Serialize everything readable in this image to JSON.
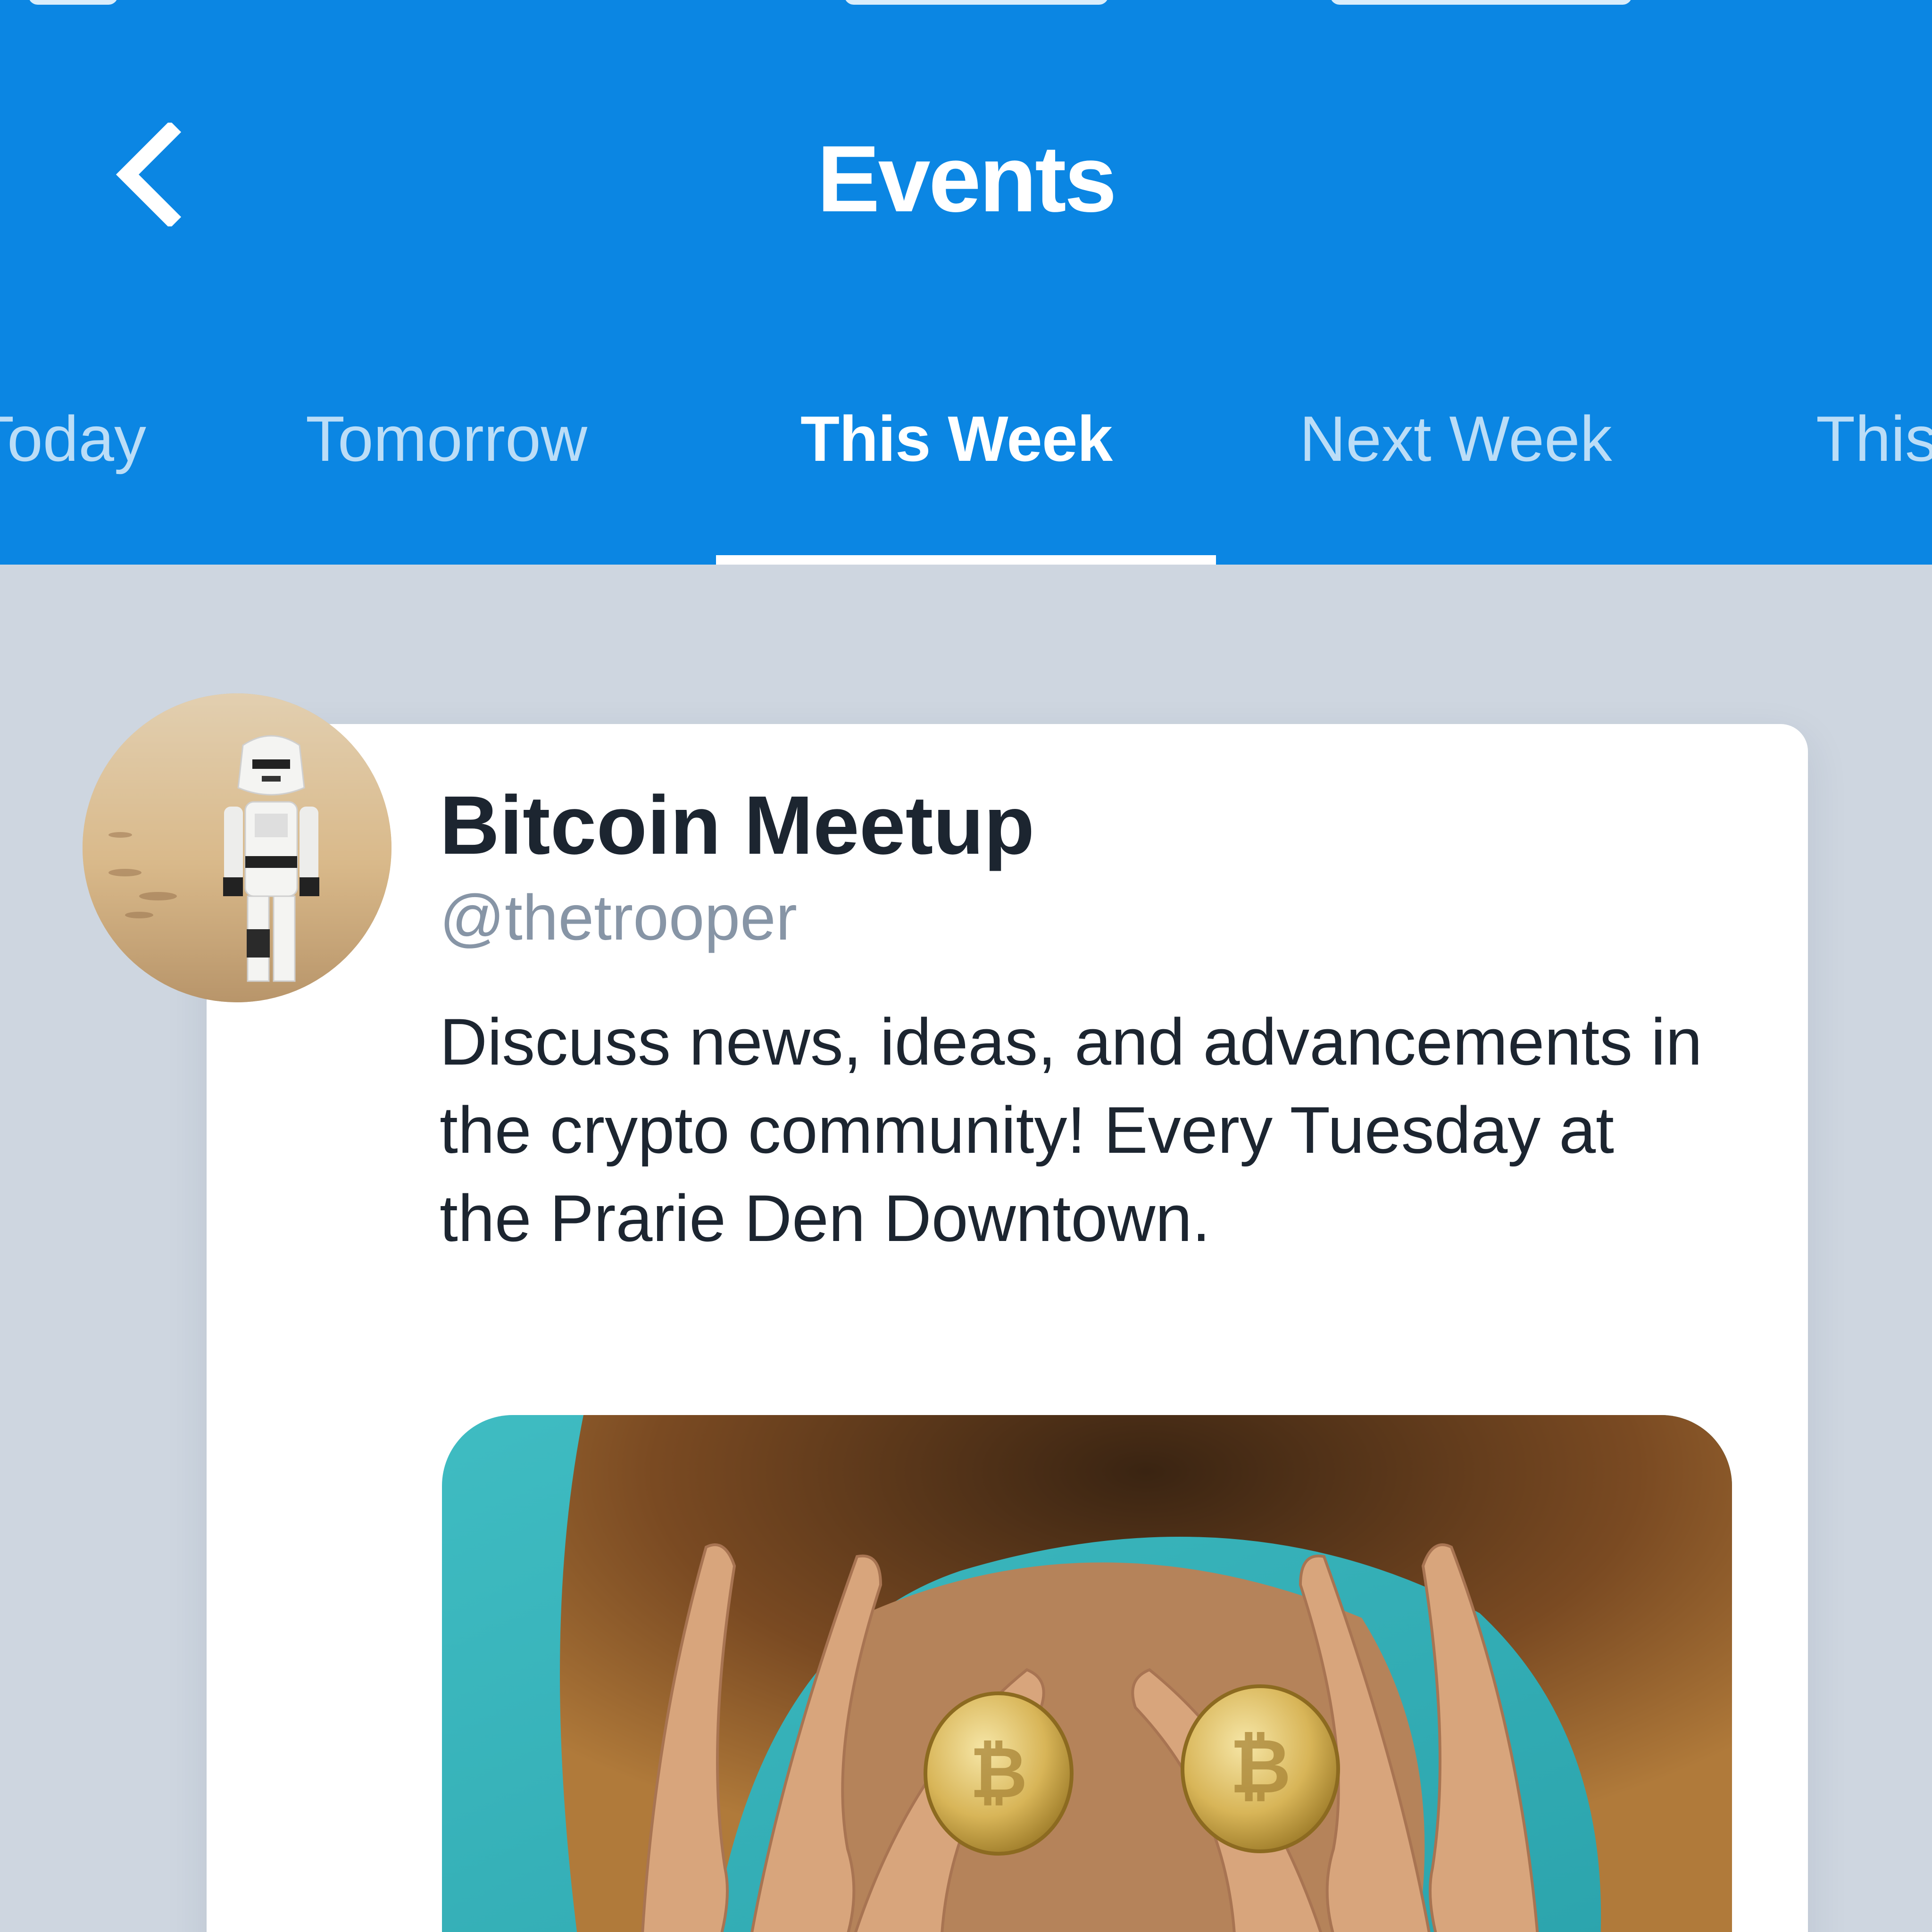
{
  "header": {
    "title": "Events",
    "back_icon": "chevron-left-icon",
    "background_color": "#0b86e3"
  },
  "tabs": {
    "items": [
      {
        "label": "Today"
      },
      {
        "label": "Tomorrow"
      },
      {
        "label": "This Week"
      },
      {
        "label": "Next Week"
      },
      {
        "label": "This"
      }
    ],
    "active_index": 2,
    "active_label": "This Week"
  },
  "event": {
    "title": "Bitcoin Meetup",
    "handle": "@thetrooper",
    "description": "Discuss news, ideas, and advancements in the crypto community! Every Tuesday at the Prarie Den Downtown.",
    "avatar": "stormtrooper-avatar",
    "image": "bitcoin-coins-photo"
  },
  "colors": {
    "accent": "#0b86e3",
    "background": "#ced6e0",
    "card": "#ffffff",
    "title_text": "#1c2530",
    "handle_text": "#8795a6"
  }
}
